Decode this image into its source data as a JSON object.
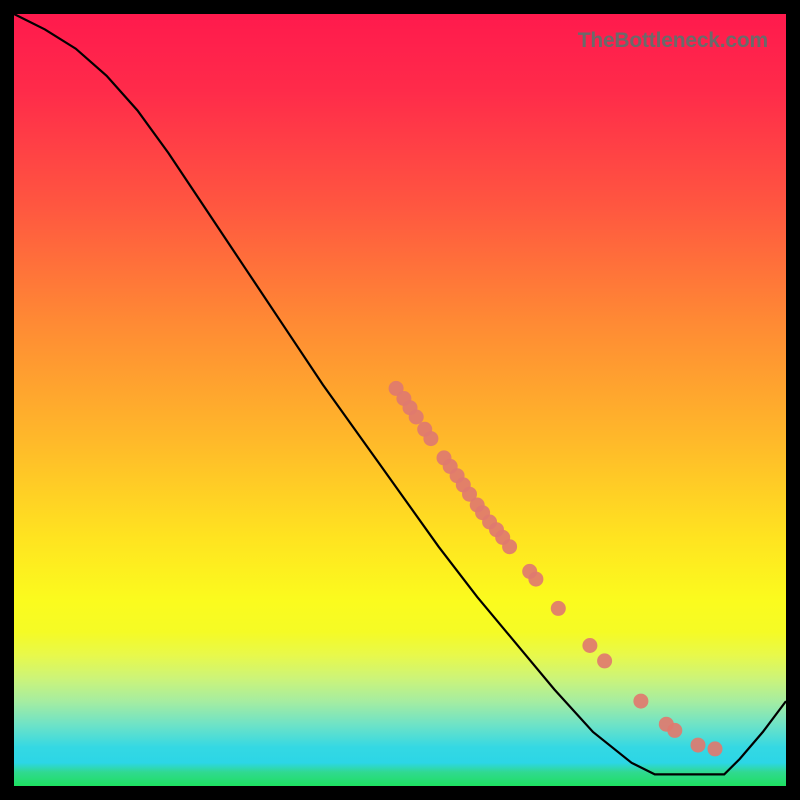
{
  "watermark": "TheBottleneck.com",
  "chart_data": {
    "type": "line",
    "title": "",
    "xlabel": "",
    "ylabel": "",
    "xlim": [
      0,
      100
    ],
    "ylim": [
      0,
      100
    ],
    "curve": [
      {
        "x": 0,
        "y": 100
      },
      {
        "x": 4,
        "y": 98
      },
      {
        "x": 8,
        "y": 95.5
      },
      {
        "x": 12,
        "y": 92
      },
      {
        "x": 16,
        "y": 87.5
      },
      {
        "x": 20,
        "y": 82
      },
      {
        "x": 25,
        "y": 74.5
      },
      {
        "x": 30,
        "y": 67
      },
      {
        "x": 35,
        "y": 59.5
      },
      {
        "x": 40,
        "y": 52
      },
      {
        "x": 45,
        "y": 45
      },
      {
        "x": 50,
        "y": 38
      },
      {
        "x": 55,
        "y": 31
      },
      {
        "x": 60,
        "y": 24.5
      },
      {
        "x": 65,
        "y": 18.5
      },
      {
        "x": 70,
        "y": 12.5
      },
      {
        "x": 75,
        "y": 7
      },
      {
        "x": 80,
        "y": 3
      },
      {
        "x": 83,
        "y": 1.5
      },
      {
        "x": 86,
        "y": 1.5
      },
      {
        "x": 89,
        "y": 1.5
      },
      {
        "x": 92,
        "y": 1.5
      },
      {
        "x": 94,
        "y": 3.5
      },
      {
        "x": 97,
        "y": 7
      },
      {
        "x": 100,
        "y": 11
      }
    ],
    "scatter": [
      {
        "x": 49.5,
        "y": 51.5
      },
      {
        "x": 50.5,
        "y": 50.2
      },
      {
        "x": 51.3,
        "y": 49
      },
      {
        "x": 52.1,
        "y": 47.8
      },
      {
        "x": 53.2,
        "y": 46.2
      },
      {
        "x": 54.0,
        "y": 45
      },
      {
        "x": 55.7,
        "y": 42.5
      },
      {
        "x": 56.5,
        "y": 41.4
      },
      {
        "x": 57.4,
        "y": 40.2
      },
      {
        "x": 58.2,
        "y": 39
      },
      {
        "x": 59.0,
        "y": 37.8
      },
      {
        "x": 60.0,
        "y": 36.4
      },
      {
        "x": 60.7,
        "y": 35.4
      },
      {
        "x": 61.6,
        "y": 34.2
      },
      {
        "x": 62.5,
        "y": 33.2
      },
      {
        "x": 63.3,
        "y": 32.2
      },
      {
        "x": 64.2,
        "y": 31
      },
      {
        "x": 66.8,
        "y": 27.8
      },
      {
        "x": 67.6,
        "y": 26.8
      },
      {
        "x": 70.5,
        "y": 23
      },
      {
        "x": 74.6,
        "y": 18.2
      },
      {
        "x": 76.5,
        "y": 16.2
      },
      {
        "x": 81.2,
        "y": 11
      },
      {
        "x": 84.5,
        "y": 8
      },
      {
        "x": 85.6,
        "y": 7.2
      },
      {
        "x": 88.6,
        "y": 5.3
      },
      {
        "x": 90.8,
        "y": 4.8
      }
    ],
    "dot_radius": 7.5
  }
}
